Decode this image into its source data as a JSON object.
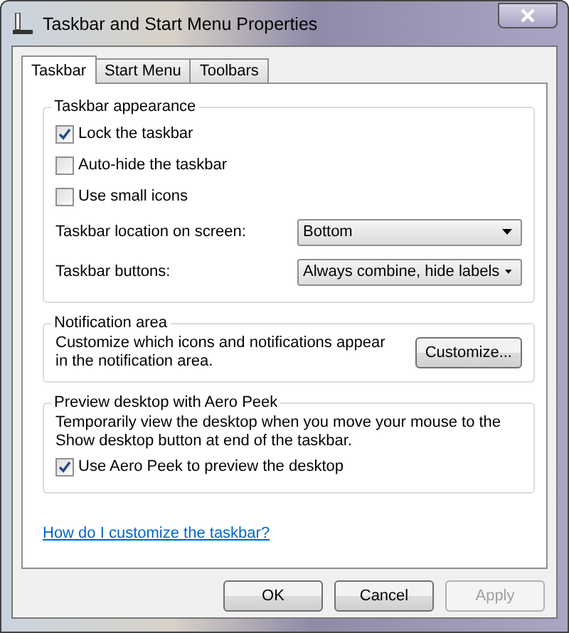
{
  "window": {
    "title": "Taskbar and Start Menu Properties"
  },
  "tabs": [
    {
      "label": "Taskbar",
      "selected": true
    },
    {
      "label": "Start Menu",
      "selected": false
    },
    {
      "label": "Toolbars",
      "selected": false
    }
  ],
  "taskbar_appearance": {
    "title": "Taskbar appearance",
    "checkboxes": [
      {
        "label": "Lock the taskbar",
        "checked": true
      },
      {
        "label": "Auto-hide the taskbar",
        "checked": false
      },
      {
        "label": "Use small icons",
        "checked": false
      }
    ],
    "dropdowns": [
      {
        "label": "Taskbar location on screen:",
        "value": "Bottom"
      },
      {
        "label": "Taskbar buttons:",
        "value": "Always combine, hide labels"
      }
    ]
  },
  "notification_area": {
    "title": "Notification area",
    "text": "Customize which icons and notifications appear in the notification area.",
    "button": "Customize..."
  },
  "aero_peek": {
    "title": "Preview desktop with Aero Peek",
    "text": "Temporarily view the desktop when you move your mouse to the Show desktop button at end of the taskbar.",
    "checkbox": {
      "label": "Use Aero Peek to preview the desktop",
      "checked": true
    }
  },
  "help_link": "How do I customize the taskbar?",
  "buttons": [
    {
      "label": "OK",
      "disabled": false
    },
    {
      "label": "Cancel",
      "disabled": false
    },
    {
      "label": "Apply",
      "disabled": true
    }
  ]
}
